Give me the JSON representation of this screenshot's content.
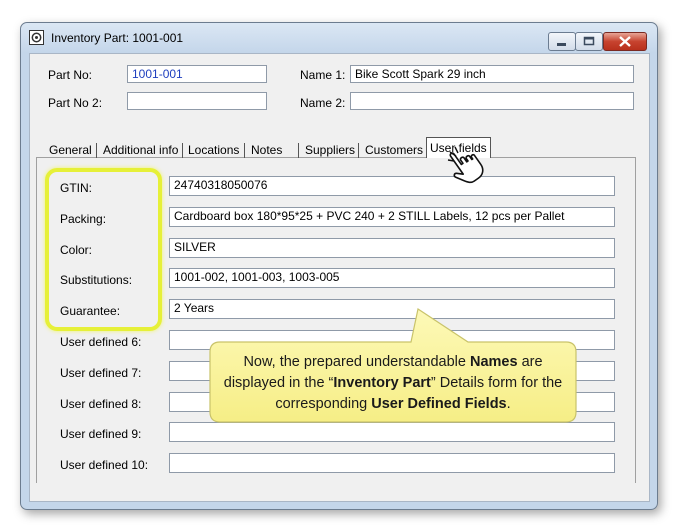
{
  "window": {
    "title": "Inventory Part: 1001-001"
  },
  "header": {
    "part_no_label": "Part No:",
    "part_no_value": "1001-001",
    "part_no2_label": "Part No 2:",
    "part_no2_value": "",
    "name1_label": "Name 1:",
    "name1_value": "Bike Scott Spark 29 inch",
    "name2_label": "Name 2:",
    "name2_value": ""
  },
  "tabs": [
    {
      "label": "General"
    },
    {
      "label": "Additional info"
    },
    {
      "label": "Locations"
    },
    {
      "label": "Notes"
    },
    {
      "label": "Suppliers"
    },
    {
      "label": "Customers"
    },
    {
      "label": "User fields",
      "active": true
    }
  ],
  "fields": [
    {
      "label": "GTIN:",
      "value": "24740318050076"
    },
    {
      "label": "Packing:",
      "value": "Cardboard box 180*95*25 + PVC 240 + 2 STILL Labels, 12 pcs per Pallet"
    },
    {
      "label": "Color:",
      "value": "SILVER"
    },
    {
      "label": "Substitutions:",
      "value": "1001-002, 1001-003, 1003-005"
    },
    {
      "label": "Guarantee:",
      "value": "2 Years"
    },
    {
      "label": "User defined 6:",
      "value": ""
    },
    {
      "label": "User defined 7:",
      "value": ""
    },
    {
      "label": "User defined 8:",
      "value": ""
    },
    {
      "label": "User defined 9:",
      "value": ""
    },
    {
      "label": "User defined 10:",
      "value": ""
    }
  ],
  "callout": {
    "t1": "Now, the prepared understandable ",
    "b1": "Names",
    "t2": " are displayed in the “",
    "b2": "Inventory Part",
    "t3": "” Details form for the corresponding ",
    "b3": "User Defined Fields",
    "t4": "."
  },
  "colors": {
    "highlight": "#e6f038",
    "callout_fill": "#fbf6a8"
  }
}
